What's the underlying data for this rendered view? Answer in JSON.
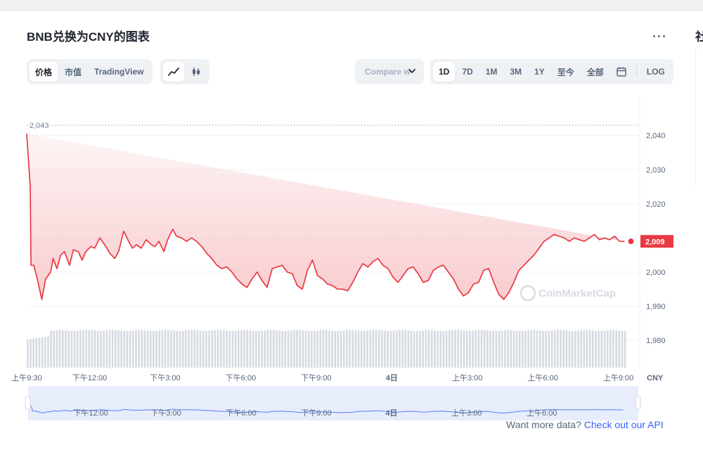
{
  "title": "BNB兑换为CNY的图表",
  "more_label": "···",
  "right_edge_glyph": "社",
  "tabs": [
    {
      "label": "价格",
      "active": true
    },
    {
      "label": "市值",
      "active": false
    },
    {
      "label": "TradingView",
      "active": false
    }
  ],
  "chart_type_icons": [
    {
      "icon": "line-chart-icon",
      "active": true
    },
    {
      "icon": "candlestick-icon",
      "active": false
    }
  ],
  "compare": {
    "label": "Compare w"
  },
  "ranges": [
    {
      "label": "1D",
      "active": true
    },
    {
      "label": "7D",
      "active": false
    },
    {
      "label": "1M",
      "active": false
    },
    {
      "label": "3M",
      "active": false
    },
    {
      "label": "1Y",
      "active": false
    },
    {
      "label": "至今",
      "active": false
    },
    {
      "label": "全部",
      "active": false
    }
  ],
  "calendar_icon": "calendar-icon",
  "log_label": "LOG",
  "footer": {
    "text": "Want more data?",
    "link": "Check out our API"
  },
  "colors": {
    "line": "#ea3943",
    "fill_top": "#f8c9cc",
    "accent": "#3861fb",
    "volume": "#d5d9e1",
    "nav_fill": "#e8edfc",
    "nav_line": "#5b7ef2"
  },
  "chart_data": {
    "type": "area",
    "title": "BNB兑换为CNY的图表",
    "currency_label": "CNY",
    "y_ticks": [
      1980,
      1990,
      2000,
      2010,
      2020,
      2030,
      2040
    ],
    "y_tick_labels": [
      "1,980",
      "1,990",
      "2,000",
      "2,010",
      "2,020",
      "2,030",
      "2,040"
    ],
    "ylim": [
      1975.5,
      2045.5
    ],
    "max_label": "2,043",
    "max_value": 2043,
    "current_label": "2,009",
    "current_value": 2009,
    "x_range_hours": [
      0,
      24.35
    ],
    "x_ticks": [
      {
        "h": 0,
        "label": "上午9:30"
      },
      {
        "h": 2.5,
        "label": "下午12:00"
      },
      {
        "h": 5.5,
        "label": "下午3:00"
      },
      {
        "h": 8.5,
        "label": "下午6:00"
      },
      {
        "h": 11.5,
        "label": "下午9:00"
      },
      {
        "h": 14.5,
        "label": "4日"
      },
      {
        "h": 17.5,
        "label": "上午3:00"
      },
      {
        "h": 20.5,
        "label": "上午6:00"
      },
      {
        "h": 23.5,
        "label": "上午9:00"
      }
    ],
    "navigator_ticks": [
      {
        "h": 2.5,
        "label": "下午12:00"
      },
      {
        "h": 5.5,
        "label": "下午3:00"
      },
      {
        "h": 8.5,
        "label": "下午6:00"
      },
      {
        "h": 11.5,
        "label": "下午9:00"
      },
      {
        "h": 14.5,
        "label": "4日"
      },
      {
        "h": 17.5,
        "label": "上午3:00"
      },
      {
        "h": 20.5,
        "label": "上午6:00"
      }
    ],
    "watermark": "CoinMarketCap",
    "series": [
      {
        "x_hours": [
          0,
          0.14,
          0.17,
          0.28,
          0.42,
          0.6,
          0.75,
          0.95,
          1.05,
          1.2,
          1.35,
          1.5,
          1.7,
          1.85,
          2.05,
          2.2,
          2.35,
          2.55,
          2.7,
          2.9,
          3.1,
          3.3,
          3.5,
          3.65,
          3.85,
          4.05,
          4.2,
          4.35,
          4.55,
          4.75,
          4.95,
          5.1,
          5.25,
          5.45,
          5.6,
          5.8,
          5.95,
          6.15,
          6.35,
          6.55,
          6.75,
          6.95,
          7.15,
          7.35,
          7.55,
          7.75,
          7.95,
          8.15,
          8.35,
          8.55,
          8.75,
          8.95,
          9.15,
          9.35,
          9.55,
          9.75,
          9.95,
          10.15,
          10.35,
          10.55,
          10.75,
          10.95,
          11.15,
          11.35,
          11.55,
          11.75,
          11.95,
          12.15,
          12.35,
          12.55,
          12.75,
          12.95,
          13.15,
          13.35,
          13.55,
          13.75,
          13.95,
          14.15,
          14.35,
          14.55,
          14.75,
          14.95,
          15.15,
          15.35,
          15.55,
          15.75,
          15.95,
          16.15,
          16.35,
          16.55,
          16.75,
          16.95,
          17.15,
          17.35,
          17.55,
          17.75,
          17.95,
          18.15,
          18.35,
          18.55,
          18.75,
          18.95,
          19.15,
          19.35,
          19.55,
          19.75,
          19.95,
          20.15,
          20.35,
          20.55,
          20.75,
          20.95,
          21.15,
          21.35,
          21.55,
          21.75,
          21.95,
          22.15,
          22.35,
          22.55,
          22.75,
          22.95,
          23.15,
          23.35,
          23.55,
          23.75,
          23.85,
          24.0
        ],
        "values": [
          2040.5,
          2025,
          2002,
          2002,
          1998,
          1992,
          1998,
          2000,
          2004,
          2001,
          2005,
          2006,
          2002,
          2006.5,
          2006,
          2003.5,
          2006,
          2007.5,
          2007,
          2010,
          2008,
          2005.5,
          2004,
          2006,
          2012,
          2009,
          2007,
          2008,
          2007,
          2009.5,
          2008,
          2007.5,
          2009,
          2006,
          2009.5,
          2012.5,
          2010.5,
          2010,
          2009,
          2010,
          2009,
          2007.5,
          2005.5,
          2004,
          2002,
          2001,
          2001.5,
          2000,
          1998,
          1996.5,
          1995.5,
          1998,
          2000,
          1997.5,
          1995.5,
          2001,
          2001.5,
          2002,
          2000,
          1999.5,
          1996,
          1995,
          2000.5,
          2003.5,
          1999,
          1998,
          1996.5,
          1996,
          1995,
          1995,
          1994.5,
          1997,
          2000,
          2002.5,
          2001.5,
          2003,
          2004,
          2002,
          2001,
          1998.5,
          1997,
          1999,
          2001,
          2001.5,
          1999.5,
          1997,
          1997.5,
          2000.5,
          2001.5,
          2002,
          2000,
          1998,
          1995,
          1993,
          1994,
          1996.5,
          1997,
          2000.5,
          2001,
          1997,
          1993.5,
          1992,
          1994,
          1997,
          2000.5,
          2002,
          2003.5,
          2005,
          2007,
          2009,
          2010,
          2011,
          2010.5,
          2010,
          2009,
          2010,
          2009.5,
          2009,
          2010,
          2011,
          2009.5,
          2010,
          2009.5,
          2010.5,
          2009,
          2009
        ]
      }
    ]
  }
}
